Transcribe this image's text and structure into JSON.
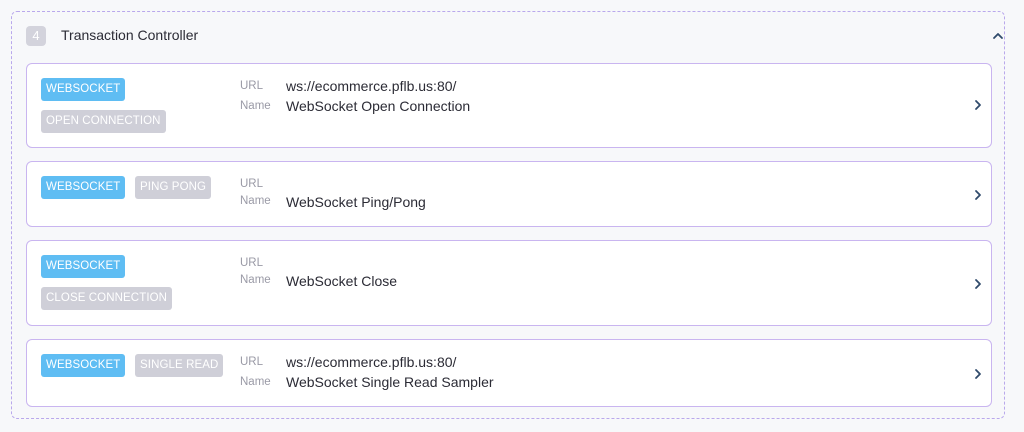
{
  "controller": {
    "number": "4",
    "title": "Transaction Controller",
    "collapse_icon": "chevron-up-icon"
  },
  "labels": {
    "url": "URL",
    "name": "Name"
  },
  "samplers": [
    {
      "protocol": "WEBSOCKET",
      "action": "OPEN CONNECTION",
      "url": "ws://ecommerce.pflb.us:80/",
      "name": "WebSocket Open Connection"
    },
    {
      "protocol": "WEBSOCKET",
      "action": "PING PONG",
      "url": "",
      "name": "WebSocket Ping/Pong"
    },
    {
      "protocol": "WEBSOCKET",
      "action": "CLOSE CONNECTION",
      "url": "",
      "name": "WebSocket Close"
    },
    {
      "protocol": "WEBSOCKET",
      "action": "SINGLE READ",
      "url": "ws://ecommerce.pflb.us:80/",
      "name": "WebSocket Single Read Sampler"
    }
  ],
  "colors": {
    "accent_tag": "#5fbdf3",
    "secondary_tag": "#cfcfd8",
    "card_border": "#c9b5f0"
  }
}
